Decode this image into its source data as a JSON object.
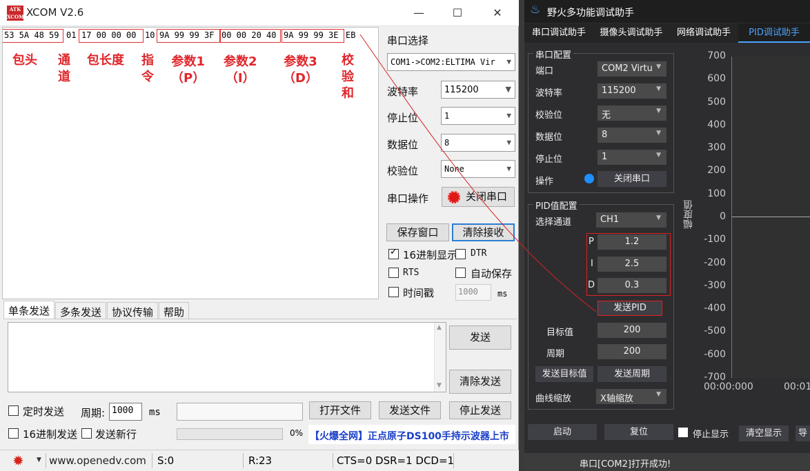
{
  "xcom": {
    "title": "XCOM V2.6",
    "logo_text": "ATK XCOM",
    "window_controls": {
      "minimize": "—",
      "maximize": "☐",
      "close": "✕"
    },
    "receive": {
      "hex_groups": [
        "53 5A 48 59",
        "01",
        "17 00 00 00",
        "10",
        "9A 99 99 3F",
        "00 00 20 40",
        "9A 99 99 3E",
        "EB"
      ],
      "labels": [
        "包头",
        "通\n道",
        "包长度",
        "指\n令",
        "参数1\n（P）",
        "参数2\n（I）",
        "参数3\n（D）",
        "校\n验\n和"
      ]
    },
    "serial": {
      "port_select_label": "串口选择",
      "port_value": "COM1->COM2:ELTIMA Vir",
      "baud_label": "波特率",
      "baud_value": "115200",
      "stop_label": "停止位",
      "stop_value": "1",
      "data_label": "数据位",
      "data_value": "8",
      "parity_label": "校验位",
      "parity_value": "None",
      "op_label": "串口操作",
      "op_button": "关闭串口"
    },
    "buttons": {
      "save_window": "保存窗口",
      "clear_receive": "清除接收",
      "send": "发送",
      "clear_send": "清除发送",
      "open_file": "打开文件",
      "send_file": "发送文件",
      "stop_send": "停止发送"
    },
    "options": {
      "hex_display": "16进制显示",
      "dtr": "DTR",
      "rts": "RTS",
      "auto_save": "自动保存",
      "timestamp": "时间戳",
      "timestamp_value": "1000",
      "timestamp_unit": "ms"
    },
    "tabs": [
      "单条发送",
      "多条发送",
      "协议传输",
      "帮助"
    ],
    "send_row": {
      "timed_send": "定时发送",
      "period_label": "周期:",
      "period_value": "1000",
      "period_unit": "ms",
      "hex_send": "16进制发送",
      "send_newline": "发送新行",
      "progress_text": "0%",
      "ad_text": "【火爆全网】正点原子DS100手持示波器上市"
    },
    "status": {
      "url": "www.openedv.com",
      "sent": "S:0",
      "received": "R:23",
      "lines": "CTS=0 DSR=1 DCD=1"
    }
  },
  "fire": {
    "title": "野火多功能调试助手",
    "tabs": [
      "串口调试助手",
      "摄像头调试助手",
      "网络调试助手",
      "PID调试助手"
    ],
    "serial_group": {
      "title": "串口配置",
      "port_label": "端口",
      "port_value": "COM2 Virtu",
      "baud_label": "波特率",
      "baud_value": "115200",
      "parity_label": "校验位",
      "parity_value": "无",
      "data_label": "数据位",
      "data_value": "8",
      "stop_label": "停止位",
      "stop_value": "1",
      "op_label": "操作",
      "op_button": "关闭串口"
    },
    "pid_group": {
      "title": "PID值配置",
      "channel_label": "选择通道",
      "channel_value": "CH1",
      "p_label": "P",
      "p_value": "1.2",
      "i_label": "I",
      "i_value": "2.5",
      "d_label": "D",
      "d_value": "0.3",
      "send_pid": "发送PID",
      "target_label": "目标值",
      "target_value": "200",
      "period_label": "周期",
      "period_value": "200",
      "send_target": "发送目标值",
      "send_period": "发送周期",
      "zoom_label": "曲线缩放",
      "zoom_value": "X轴缩放"
    },
    "chart": {
      "ylabel": "幅度值",
      "yticks": [
        "700",
        "600",
        "500",
        "400",
        "300",
        "200",
        "100",
        "0",
        "-100",
        "-200",
        "-300",
        "-400",
        "-500",
        "-600",
        "-700"
      ],
      "xticks": [
        "00:00:000",
        "00:01"
      ]
    },
    "bottom": {
      "start": "启动",
      "reset": "复位",
      "stop_display": "停止显示",
      "clear_display": "清空显示",
      "export": "导"
    },
    "status": "串口[COM2]打开成功!"
  },
  "colors": {
    "red_annotation": "#e0262b",
    "accent_blue": "#1e90ff",
    "dark_bg": "#2d2d30"
  }
}
